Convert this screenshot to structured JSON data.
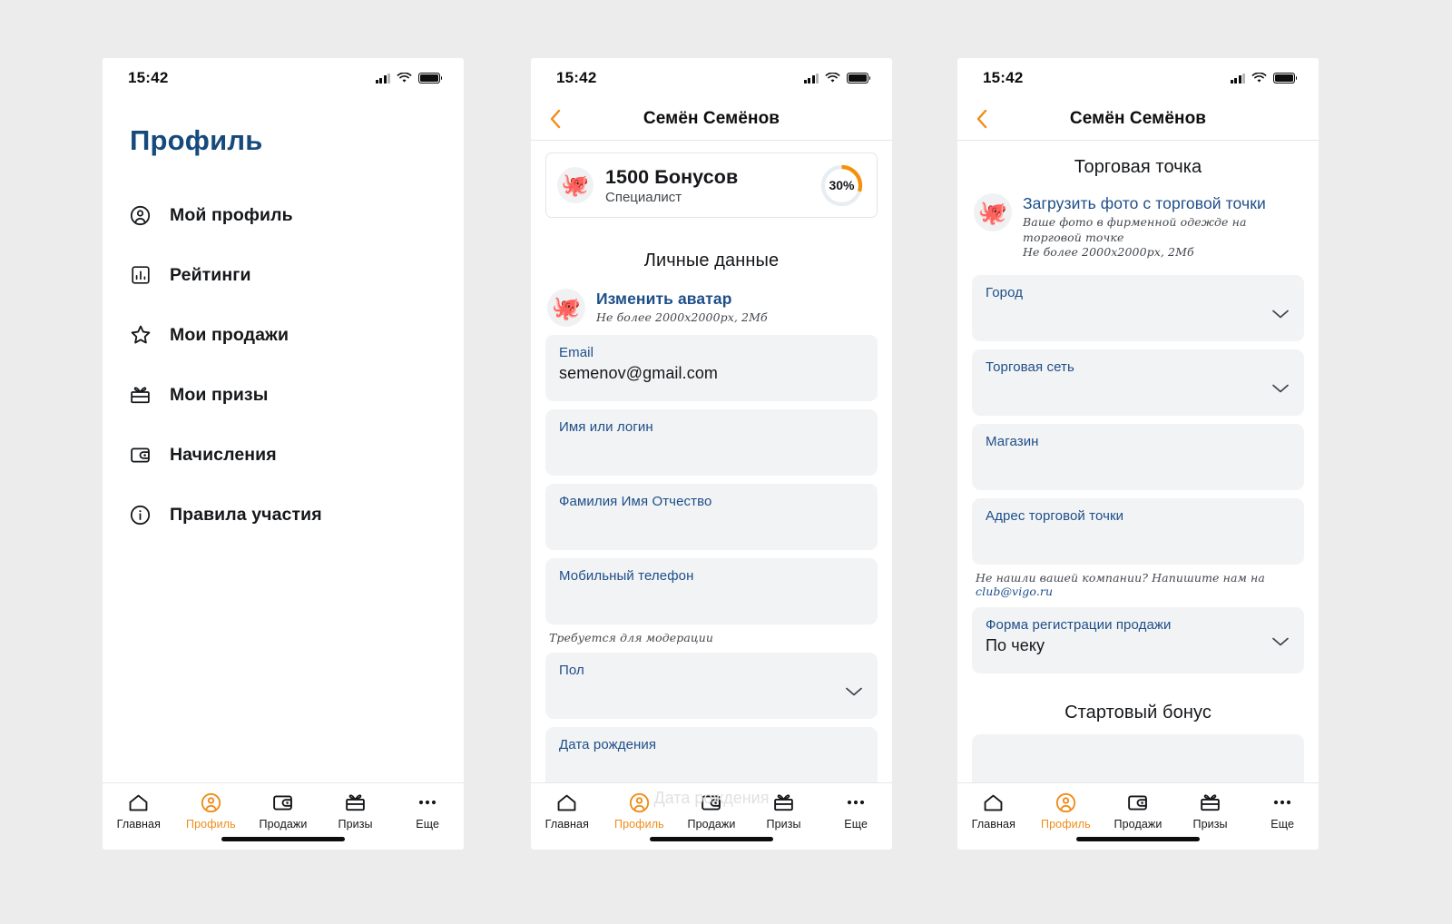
{
  "status_bar": {
    "time": "15:42"
  },
  "colors": {
    "accent_orange": "#f08c18",
    "brand_blue": "#174a7c",
    "label_blue": "#1d4e89",
    "field_bg": "#f2f3f4",
    "text_dark": "#15171a"
  },
  "screen1": {
    "page_title": "Профиль",
    "menu": [
      {
        "icon": "user-circle-icon",
        "label": "Мой профиль"
      },
      {
        "icon": "bar-chart-icon",
        "label": "Рейтинги"
      },
      {
        "icon": "star-icon",
        "label": "Мои продажи"
      },
      {
        "icon": "gift-icon",
        "label": "Мои призы"
      },
      {
        "icon": "wallet-icon",
        "label": "Начисления"
      },
      {
        "icon": "info-circle-icon",
        "label": "Правила участия"
      }
    ]
  },
  "screen2": {
    "nav_title": "Семён Семёнов",
    "back_icon": "chevron-left-icon",
    "bonus_card": {
      "avatar_icon": "octopus-avatar",
      "amount": "1500 Бонусов",
      "level": "Специалист",
      "progress_label": "30%",
      "progress_value": 30
    },
    "section_title": "Личные данные",
    "avatar_upload": {
      "avatar_icon": "octopus-avatar",
      "link": "Изменить аватар",
      "hint": "Не более 2000х2000px, 2Мб"
    },
    "fields": [
      {
        "label": "Email",
        "value": "semenov@gmail.com",
        "type": "text"
      },
      {
        "label": "Имя или логин",
        "value": "",
        "type": "text"
      },
      {
        "label": "Фамилия Имя Отчество",
        "value": "",
        "type": "text"
      },
      {
        "label": "Мобильный телефон",
        "value": "",
        "type": "text",
        "hint": "Требуется для модерации"
      },
      {
        "label": "Пол",
        "value": "",
        "type": "select"
      }
    ],
    "ghost_text": "Дата рождения"
  },
  "screen3": {
    "nav_title": "Семён Семёнов",
    "back_icon": "chevron-left-icon",
    "section_title": "Торговая точка",
    "photo_upload": {
      "avatar_icon": "octopus-avatar",
      "link": "Загрузить фото с торговой точки",
      "hint_line1": "Ваше фото в фирменной одежде на торговой точке",
      "hint_line2": "Не более 2000х2000px, 2Мб"
    },
    "fields": [
      {
        "label": "Город",
        "value": "",
        "type": "select"
      },
      {
        "label": "Торговая сеть",
        "value": "",
        "type": "select"
      },
      {
        "label": "Магазин",
        "value": "",
        "type": "text"
      },
      {
        "label": "Адрес торговой точки",
        "value": "",
        "type": "text"
      }
    ],
    "company_hint_prefix": "Не нашли вашей компании? Напишите нам на ",
    "company_hint_email": "club@vigo.ru",
    "sale_form": {
      "label": "Форма регистрации продажи",
      "value": "По чеку",
      "type": "select"
    },
    "bonus_section_title": "Стартовый бонус"
  },
  "tabbar": {
    "items": [
      {
        "icon": "home-icon",
        "label": "Главная",
        "active": false
      },
      {
        "icon": "profile-icon",
        "label": "Профиль",
        "active": true
      },
      {
        "icon": "wallet-icon",
        "label": "Продажи",
        "active": false
      },
      {
        "icon": "gift-icon",
        "label": "Призы",
        "active": false
      },
      {
        "icon": "ellipsis-icon",
        "label": "Еще",
        "active": false
      }
    ]
  }
}
